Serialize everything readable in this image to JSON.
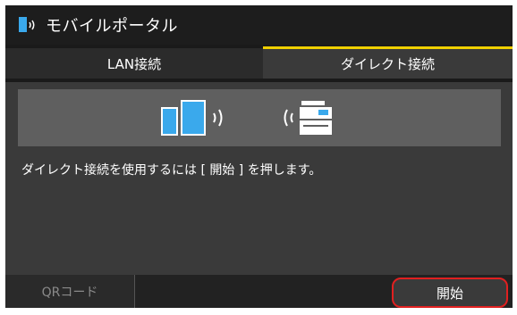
{
  "title": "モバイルポータル",
  "tabs": [
    {
      "label": "LAN接続",
      "active": false
    },
    {
      "label": "ダイレクト接続",
      "active": true
    }
  ],
  "message": "ダイレクト接続を使用するには [ 開始 ] を押します。",
  "bottom": {
    "qr_label": "QRコード",
    "start_label": "開始"
  },
  "icons": [
    "mobile-portal-icon",
    "phone-icon",
    "tablet-icon",
    "signal-waves-icon",
    "printer-icon"
  ],
  "colors": {
    "accent_tab": "#f0d000",
    "highlight_border": "#e02020",
    "icon_blue": "#3aa9ec"
  }
}
